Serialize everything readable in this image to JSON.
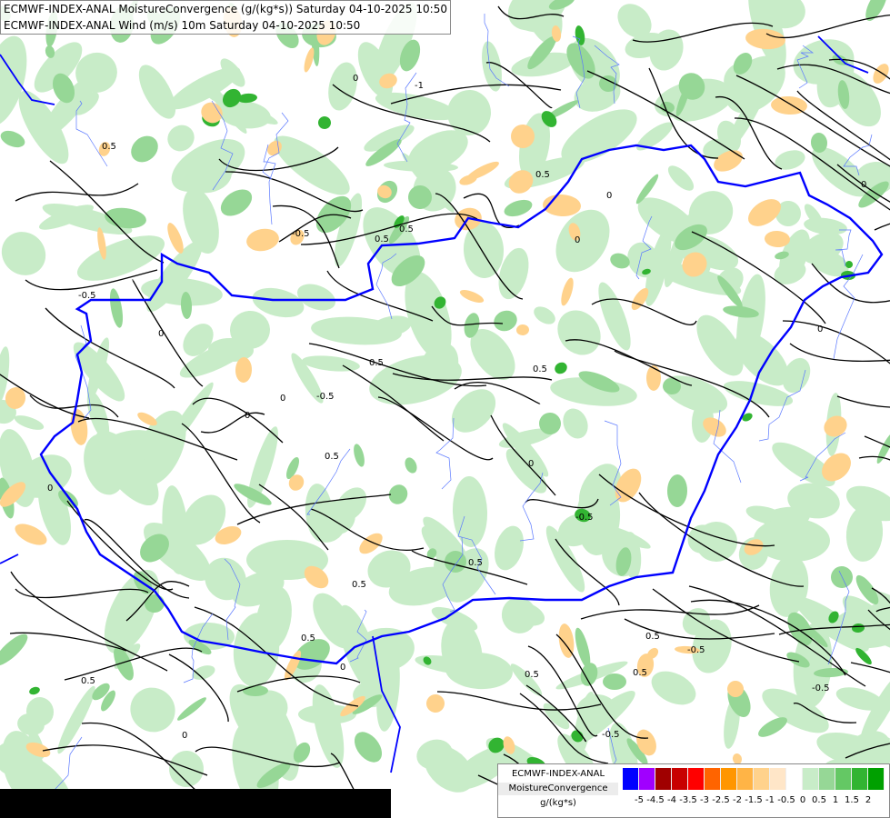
{
  "titles": {
    "line1": "ECMWF-INDEX-ANAL MoistureConvergence (g/(kg*s)) Saturday 04-10-2025 10:50",
    "line2": "ECMWF-INDEX-ANAL Wind (m/s) 10m Saturday 04-10-2025 10:50"
  },
  "legend": {
    "name1": "ECMWF-INDEX-ANAL",
    "name2": "MoistureConvergence",
    "unit": "g/(kg*s)",
    "colors": [
      "#0000ff",
      "#a000ff",
      "#a00000",
      "#c80000",
      "#ff0000",
      "#ff6400",
      "#ff9600",
      "#ffb446",
      "#ffd28c",
      "#ffe6c8",
      "#ffffff",
      "#c8ecc8",
      "#96d796",
      "#64c864",
      "#32b432",
      "#00a000"
    ],
    "ticks": [
      "-5",
      "-4.5",
      "-4",
      "-3.5",
      "-3",
      "-2.5",
      "-2",
      "-1.5",
      "-1",
      "-0.5",
      "0",
      "0.5",
      "1",
      "1.5",
      "2"
    ]
  },
  "contour_labels": [
    "0",
    "0.5",
    "-0.5",
    "-1",
    "0.5",
    "0",
    "-0.5",
    "0.5",
    "0",
    "0.5",
    "0",
    "-0.5",
    "0.5",
    "0",
    "0.5",
    "-0.5",
    "0",
    "0.5",
    "0.5",
    "0",
    "-0.5",
    "0.5",
    "0",
    "0.5",
    "0.5",
    "0",
    "0.5",
    "-0.5",
    "0",
    "0.5",
    "0",
    "-0.5",
    "0.5",
    "0"
  ],
  "colors": {
    "border": "#0000ff",
    "streamline": "#000000",
    "convergence_light": "#c8ecc8",
    "convergence_mid": "#96d796",
    "convergence_strong": "#32b432",
    "divergence_light": "#ffd28c",
    "nodata": "#000000"
  }
}
